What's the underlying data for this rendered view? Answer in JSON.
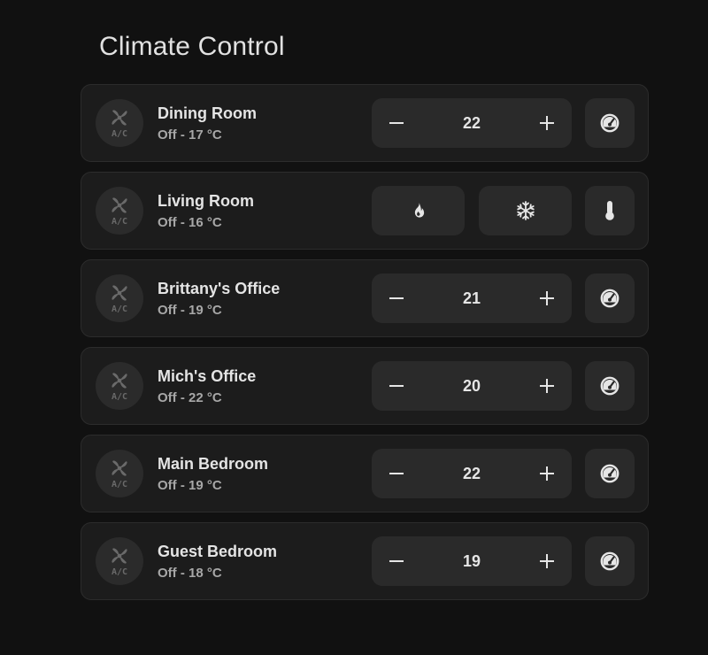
{
  "page": {
    "title": "Climate Control"
  },
  "colors": {
    "background": "#111111",
    "card": "#1c1c1c",
    "control": "#2a2a2a",
    "text_primary": "#e4e4e4",
    "text_secondary": "#a7a7a7"
  },
  "rooms": [
    {
      "name": "Dining Room",
      "state": "Off - 17 °C",
      "icon": "air-conditioner-icon",
      "control": "stepper",
      "setpoint": "22",
      "side_icon": "gauge-icon"
    },
    {
      "name": "Living Room",
      "state": "Off - 16 °C",
      "icon": "air-conditioner-icon",
      "control": "modes",
      "modes": [
        "flame-icon",
        "snowflake-icon"
      ],
      "side_icon": "thermometer-icon"
    },
    {
      "name": "Brittany's Office",
      "state": "Off - 19 °C",
      "icon": "air-conditioner-icon",
      "control": "stepper",
      "setpoint": "21",
      "side_icon": "gauge-icon"
    },
    {
      "name": "Mich's Office",
      "state": "Off - 22 °C",
      "icon": "air-conditioner-icon",
      "control": "stepper",
      "setpoint": "20",
      "side_icon": "gauge-icon"
    },
    {
      "name": "Main Bedroom",
      "state": "Off - 19 °C",
      "icon": "air-conditioner-icon",
      "control": "stepper",
      "setpoint": "22",
      "side_icon": "gauge-icon"
    },
    {
      "name": "Guest Bedroom",
      "state": "Off - 18 °C",
      "icon": "air-conditioner-icon",
      "control": "stepper",
      "setpoint": "19",
      "side_icon": "gauge-icon"
    }
  ]
}
